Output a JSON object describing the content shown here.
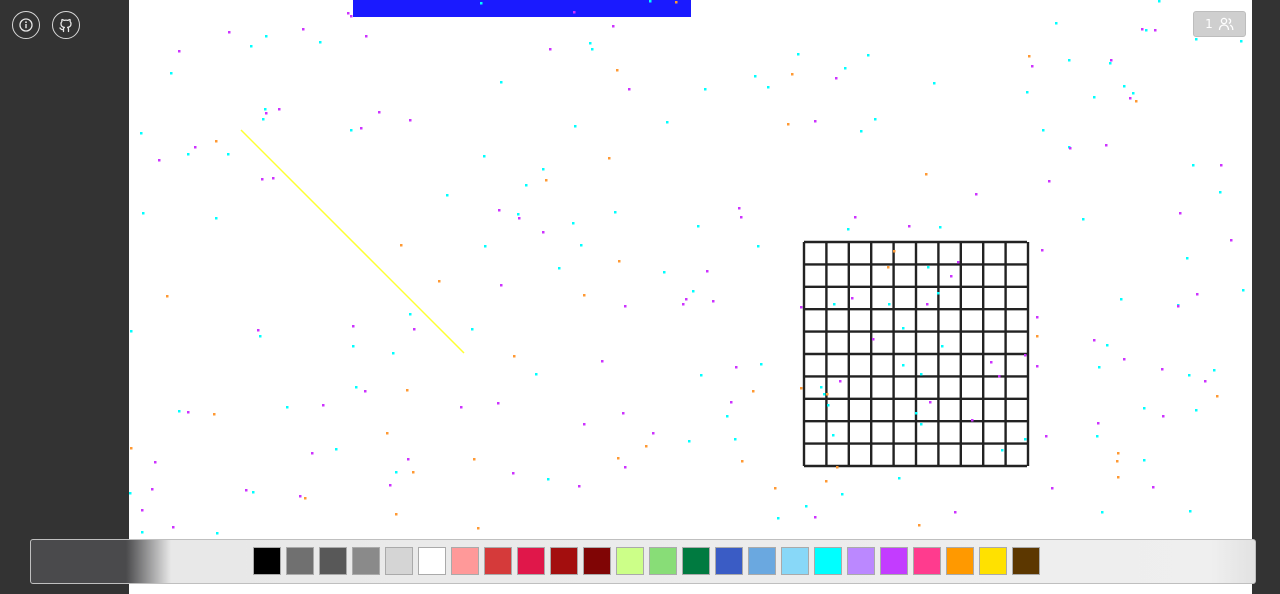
{
  "icons": {
    "info": "info-icon",
    "github": "github-icon",
    "users": "users-icon"
  },
  "users": {
    "count": "1"
  },
  "colors": {
    "chrome": "#333333",
    "canvas": "#ffffff",
    "blue_block": "#1a1aff",
    "stroke_line": "#ffff33",
    "grid": "#222222",
    "dot_colors": [
      "#00ffff",
      "#cc33ff",
      "#ff9933"
    ]
  },
  "palette": [
    "#000000",
    "#707070",
    "#585858",
    "#8a8a8a",
    "#d5d5d5",
    "#ffffff",
    "#ff9999",
    "#d53a3a",
    "#e0174a",
    "#a30e0e",
    "#800505",
    "#ccff88",
    "#88dd77",
    "#007a40",
    "#3a5cc5",
    "#6aa8e0",
    "#88d8f8",
    "#00ffff",
    "#bb88ff",
    "#c33cff",
    "#ff3b8e",
    "#ff9900",
    "#ffe100",
    "#5c3700"
  ]
}
